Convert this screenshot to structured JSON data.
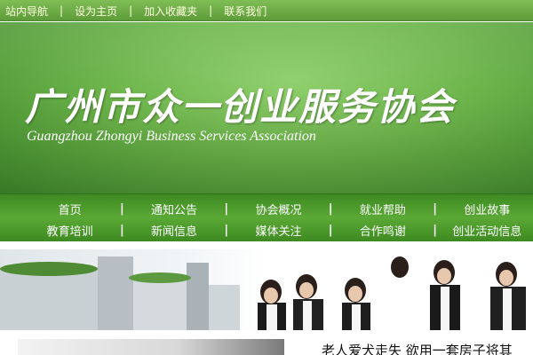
{
  "top_links": [
    "站内导航",
    "设为主页",
    "加入收藏夹",
    "联系我们"
  ],
  "top_sep": "|",
  "banner": {
    "title_cn": "广州市众一创业服务协会",
    "title_en": "Guangzhou Zhongyi Business Services Association"
  },
  "nav": {
    "sep": "|",
    "row1": [
      "首页",
      "通知公告",
      "协会概况",
      "就业帮助",
      "创业故事"
    ],
    "row2": [
      "教育培训",
      "新闻信息",
      "媒体关注",
      "合作鸣谢",
      "创业活动信息"
    ]
  },
  "news": {
    "headline": "老人爱犬走失  欲用一套房子将其"
  },
  "colors": {
    "top_strip": "#6fae47",
    "banner": "#6cb44a",
    "nav": "#4a9a2a",
    "link_text": "#fffde0"
  }
}
